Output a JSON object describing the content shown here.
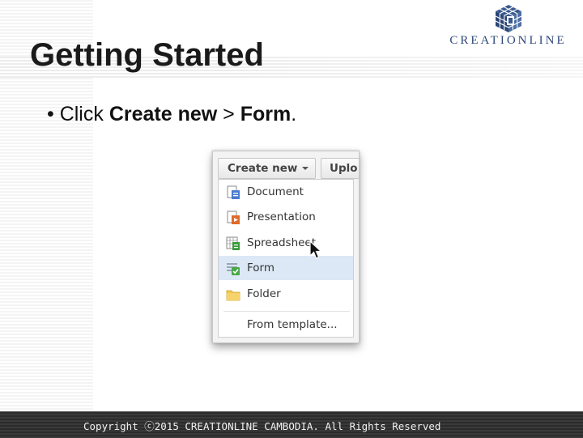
{
  "slide": {
    "title": "Getting Started",
    "bullet": {
      "prefix": "• Click ",
      "bold1": "Create new",
      "sep": " > ",
      "bold2": "Form",
      "suffix": "."
    }
  },
  "logo": {
    "text": "CREATIONLINE",
    "icon": "cube-logo-icon"
  },
  "screenshot": {
    "create_button": "Create new",
    "upload_button": "Uplo",
    "menu_items": [
      {
        "label": "Document",
        "icon": "document-icon",
        "color": "#4a7bd0"
      },
      {
        "label": "Presentation",
        "icon": "presentation-icon",
        "color": "#e06a2a"
      },
      {
        "label": "Spreadsheet",
        "icon": "spreadsheet-icon",
        "color": "#3a9a3a"
      },
      {
        "label": "Form",
        "icon": "form-icon",
        "color": "#48a848",
        "selected": true
      },
      {
        "label": "Folder",
        "icon": "folder-icon",
        "color": "#f2c94c"
      },
      {
        "label": "From template...",
        "icon": null
      }
    ]
  },
  "footer": {
    "copyright": "Copyright ⓒ2015 CREATIONLINE CAMBODIA. All Rights Reserved"
  },
  "colors": {
    "accent": "#2e4a7a",
    "selected_row": "#dce8f6",
    "footer_bg": "#2b2b2b"
  }
}
